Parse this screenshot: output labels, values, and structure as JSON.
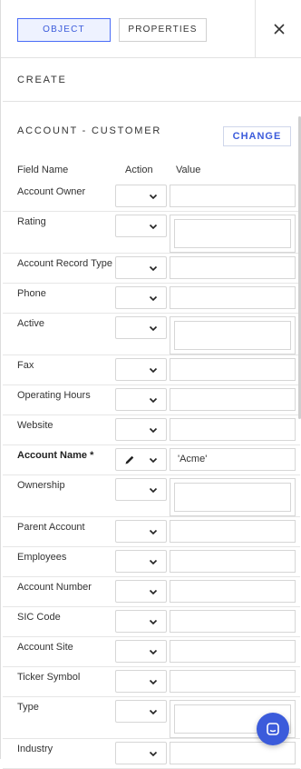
{
  "tabs": {
    "object": "OBJECT",
    "properties": "PROPERTIES"
  },
  "close_label": "×",
  "create_label": "CREATE",
  "object_title": "ACCOUNT - CUSTOMER",
  "change_label": "CHANGE",
  "columns": {
    "field": "Field Name",
    "action": "Action",
    "value": "Value"
  },
  "fields": [
    {
      "name": "Account Owner",
      "value": "",
      "tall": false,
      "required": false,
      "pencil": false
    },
    {
      "name": "Rating",
      "value": "",
      "tall": true,
      "required": false,
      "pencil": false
    },
    {
      "name": "Account Record Type",
      "value": "",
      "tall": false,
      "required": false,
      "pencil": false
    },
    {
      "name": "Phone",
      "value": "",
      "tall": false,
      "required": false,
      "pencil": false
    },
    {
      "name": "Active",
      "value": "",
      "tall": true,
      "required": false,
      "pencil": false
    },
    {
      "name": "Fax",
      "value": "",
      "tall": false,
      "required": false,
      "pencil": false
    },
    {
      "name": "Operating Hours",
      "value": "",
      "tall": false,
      "required": false,
      "pencil": false
    },
    {
      "name": "Website",
      "value": "",
      "tall": false,
      "required": false,
      "pencil": false
    },
    {
      "name": "Account Name *",
      "value": "'Acme'",
      "tall": false,
      "required": true,
      "pencil": true
    },
    {
      "name": "Ownership",
      "value": "",
      "tall": true,
      "required": false,
      "pencil": false
    },
    {
      "name": "Parent Account",
      "value": "",
      "tall": false,
      "required": false,
      "pencil": false
    },
    {
      "name": "Employees",
      "value": "",
      "tall": false,
      "required": false,
      "pencil": false
    },
    {
      "name": "Account Number",
      "value": "",
      "tall": false,
      "required": false,
      "pencil": false
    },
    {
      "name": "SIC Code",
      "value": "",
      "tall": false,
      "required": false,
      "pencil": false
    },
    {
      "name": "Account Site",
      "value": "",
      "tall": false,
      "required": false,
      "pencil": false
    },
    {
      "name": "Ticker Symbol",
      "value": "",
      "tall": false,
      "required": false,
      "pencil": false
    },
    {
      "name": "Type",
      "value": "",
      "tall": true,
      "required": false,
      "pencil": false
    },
    {
      "name": "Industry",
      "value": "",
      "tall": false,
      "required": false,
      "pencil": false
    }
  ],
  "colors": {
    "accent": "#3b5bdb",
    "border": "#d6d6d6"
  },
  "icons": {
    "close": "close-icon",
    "chevron": "chevron-down-icon",
    "pencil": "pencil-icon",
    "chat": "chat-icon"
  }
}
